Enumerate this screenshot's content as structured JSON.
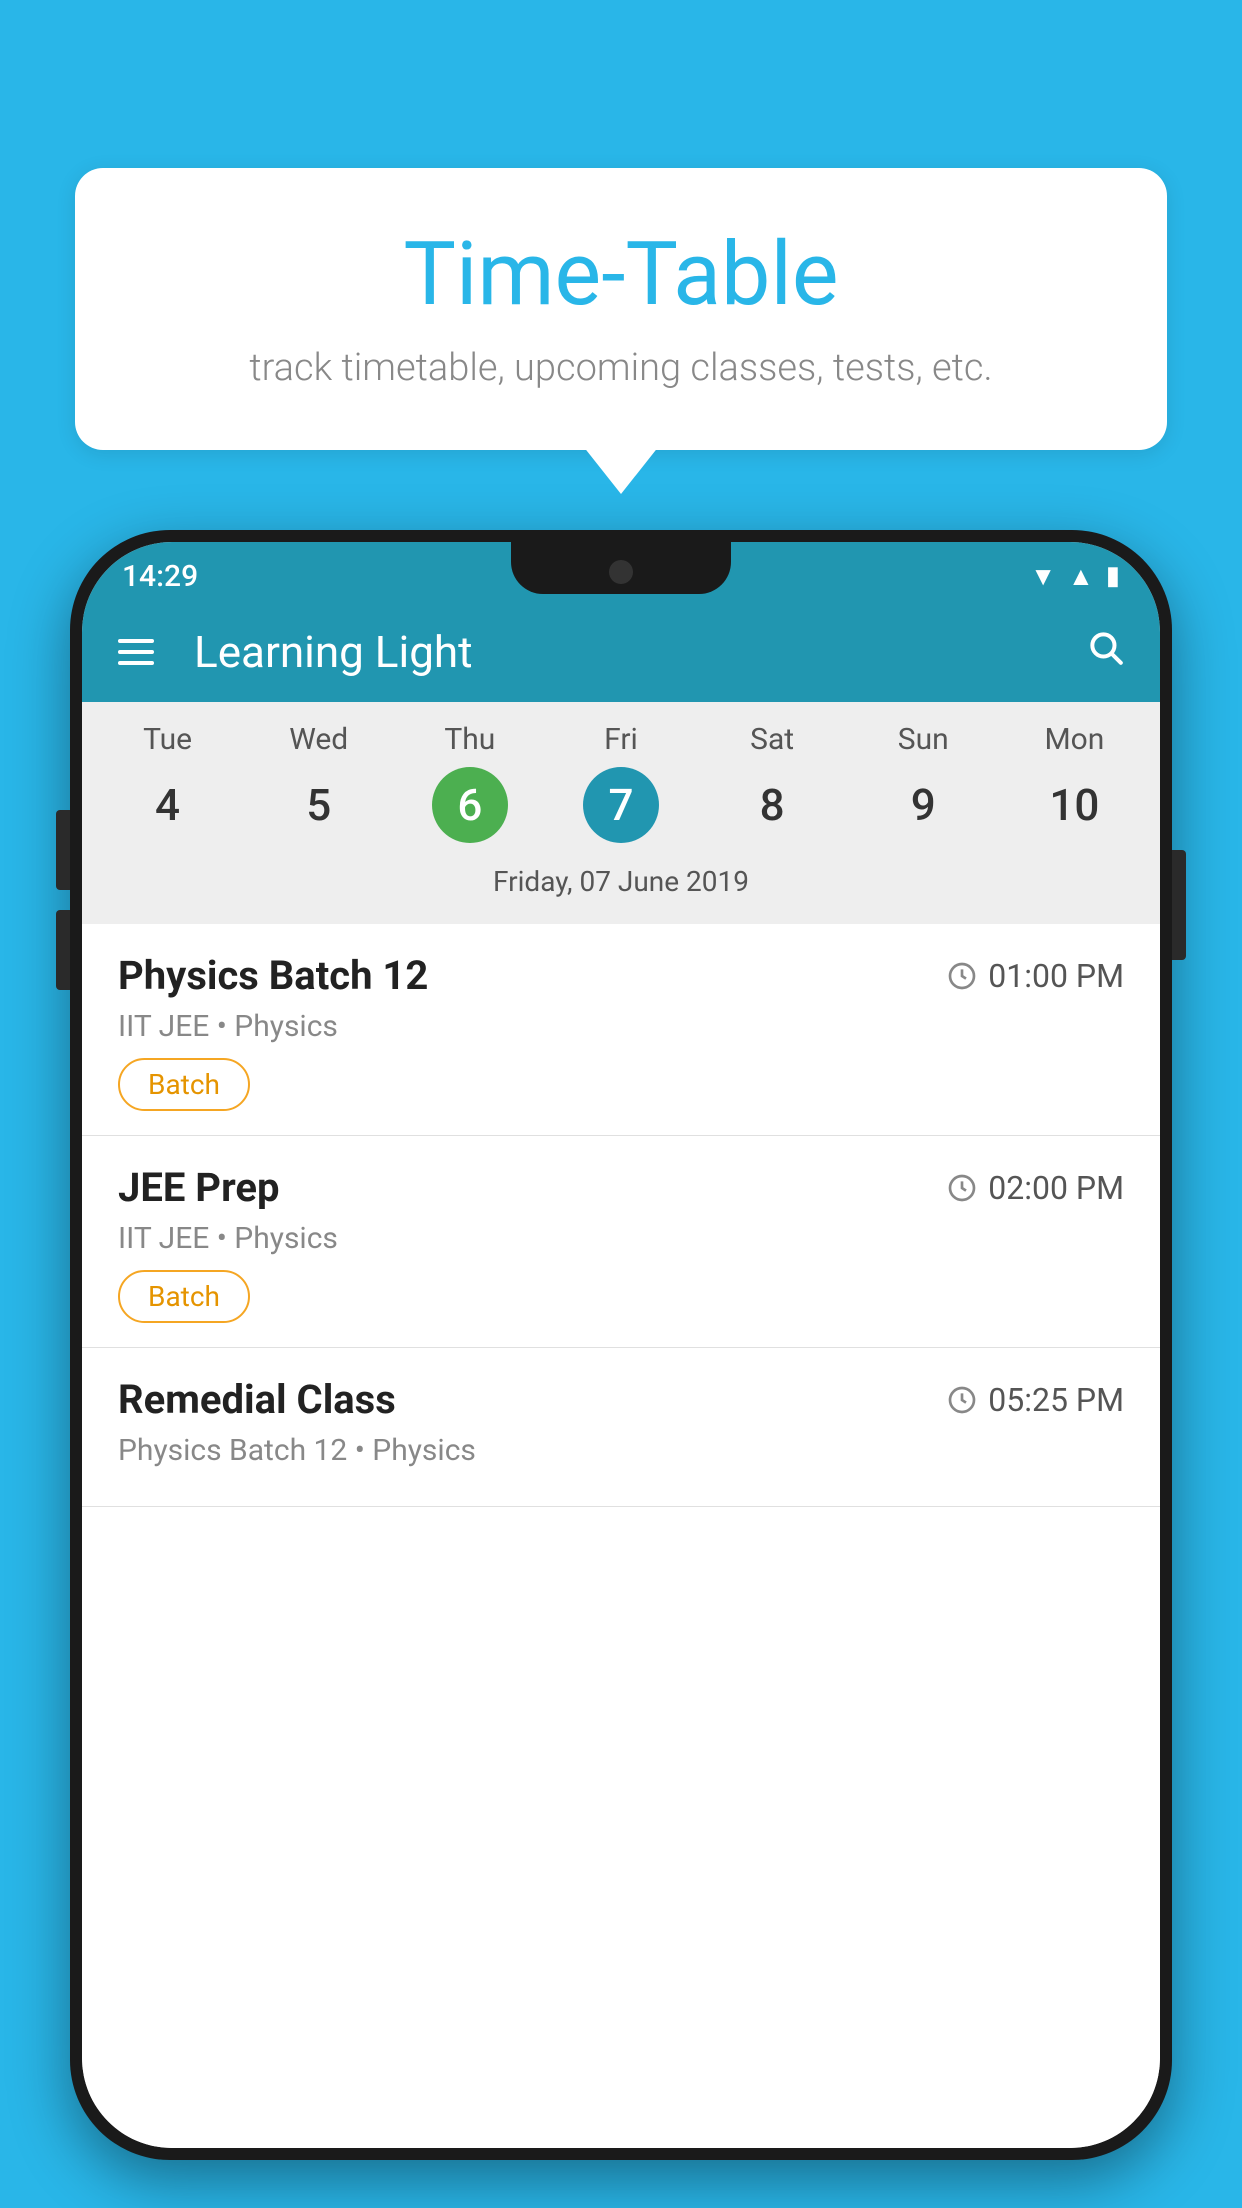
{
  "background_color": "#29B6E8",
  "bubble": {
    "title": "Time-Table",
    "subtitle": "track timetable, upcoming classes, tests, etc."
  },
  "app": {
    "app_bar_title": "Learning Light",
    "status_time": "14:29"
  },
  "calendar": {
    "days": [
      {
        "name": "Tue",
        "num": "4",
        "state": "normal"
      },
      {
        "name": "Wed",
        "num": "5",
        "state": "normal"
      },
      {
        "name": "Thu",
        "num": "6",
        "state": "today"
      },
      {
        "name": "Fri",
        "num": "7",
        "state": "selected"
      },
      {
        "name": "Sat",
        "num": "8",
        "state": "normal"
      },
      {
        "name": "Sun",
        "num": "9",
        "state": "normal"
      },
      {
        "name": "Mon",
        "num": "10",
        "state": "normal"
      }
    ],
    "selected_date_label": "Friday, 07 June 2019"
  },
  "schedule": [
    {
      "title": "Physics Batch 12",
      "time": "01:00 PM",
      "sub": "IIT JEE • Physics",
      "badge": "Batch"
    },
    {
      "title": "JEE Prep",
      "time": "02:00 PM",
      "sub": "IIT JEE • Physics",
      "badge": "Batch"
    },
    {
      "title": "Remedial Class",
      "time": "05:25 PM",
      "sub": "Physics Batch 12 • Physics",
      "badge": null
    }
  ],
  "icons": {
    "hamburger": "☰",
    "search": "🔍",
    "clock": "🕐"
  }
}
